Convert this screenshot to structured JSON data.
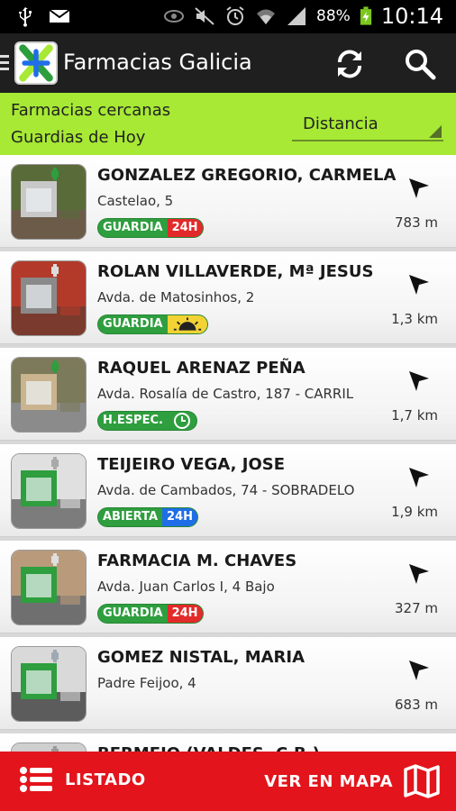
{
  "status_bar": {
    "icons_left": [
      "usb-icon",
      "mail-icon"
    ],
    "icons_right": [
      "eye-icon",
      "mute-icon",
      "alarm-icon",
      "wifi-icon",
      "signal-icon"
    ],
    "battery": "88%",
    "time": "10:14"
  },
  "app_bar": {
    "title": "Farmacias Galicia",
    "actions": [
      "refresh-icon",
      "search-icon"
    ]
  },
  "filter": {
    "line1": "Farmacias cercanas",
    "line2": "Guardias de Hoy",
    "sort_selected": "Distancia"
  },
  "colors": {
    "accent_green": "#a7e934",
    "bottom_red": "#e3141b",
    "guardia_green": "#2e9e3e",
    "badge_red": "#e22a2a",
    "badge_blue": "#1f6ee8",
    "badge_yellow": "#f3d234"
  },
  "pharmacies": [
    {
      "name": "GONZALEZ GREGORIO, CARMELA",
      "address": "Castelao, 5",
      "badge": "GUARDIA",
      "badge_extra": "24H",
      "badge_kind": "guardia-24h",
      "distance": "783 m"
    },
    {
      "name": "ROLAN VILLAVERDE, Mª JESUS",
      "address": "Avda. de Matosinhos, 2",
      "badge": "GUARDIA",
      "badge_extra": "",
      "badge_kind": "guardia-day",
      "distance": "1,3 km"
    },
    {
      "name": "RAQUEL ARENAZ PEÑA",
      "address": "Avda. Rosalía de Castro, 187 - CARRIL",
      "badge": "H.ESPEC.",
      "badge_extra": "",
      "badge_kind": "hespec-clock",
      "distance": "1,7 km"
    },
    {
      "name": "TEIJEIRO VEGA, JOSE",
      "address": "Avda. de Cambados, 74 - SOBRADELO",
      "badge": "ABIERTA",
      "badge_extra": "24H",
      "badge_kind": "abierta-24h",
      "distance": "1,9 km"
    },
    {
      "name": "FARMACIA M. CHAVES",
      "address": "Avda. Juan Carlos I, 4 Bajo",
      "badge": "GUARDIA",
      "badge_extra": "24H",
      "badge_kind": "guardia-24h",
      "distance": "327 m"
    },
    {
      "name": "GOMEZ NISTAL, MARIA",
      "address": "Padre Feijoo, 4",
      "badge": "",
      "badge_extra": "",
      "badge_kind": "none",
      "distance": "683 m"
    },
    {
      "name": "BERMEJO (VALDES, C.B.)",
      "address": "",
      "badge": "",
      "badge_extra": "",
      "badge_kind": "none",
      "distance": ""
    }
  ],
  "bottom_bar": {
    "left_label": "LISTADO",
    "right_label": "VER EN MAPA"
  }
}
